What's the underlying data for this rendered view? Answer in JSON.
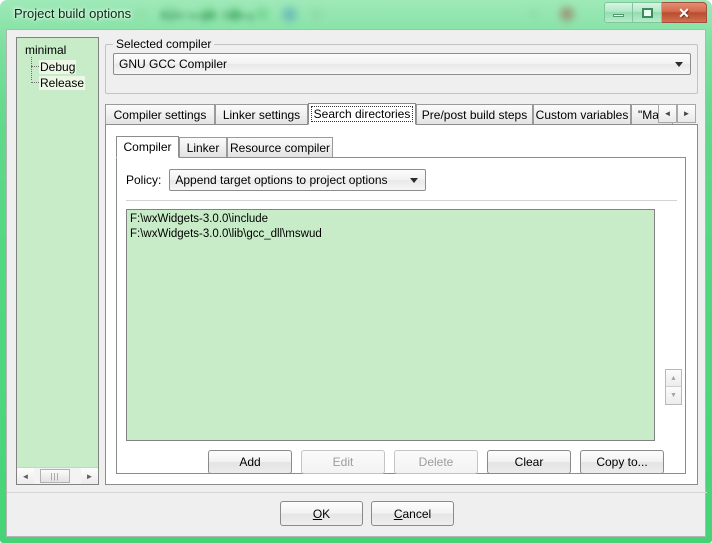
{
  "window": {
    "title": "Project build options",
    "glass_ghost_text": "Build target: Debug",
    "caption": {
      "minimize": "–",
      "maximize": "□",
      "close": "✕"
    }
  },
  "tree": {
    "root": "minimal",
    "children": [
      "Debug",
      "Release"
    ],
    "scroll_left": "◄",
    "scroll_right": "►",
    "thumb_grip": "|||"
  },
  "compiler_group": {
    "label": "Selected compiler",
    "selected": "GNU GCC Compiler"
  },
  "tabs": {
    "items": [
      {
        "label": "Compiler settings",
        "active": false
      },
      {
        "label": "Linker settings",
        "active": false
      },
      {
        "label": "Search directories",
        "active": true
      },
      {
        "label": "Pre/post build steps",
        "active": false
      },
      {
        "label": "Custom variables",
        "active": false
      },
      {
        "label": "\"Make\"",
        "active": false
      }
    ],
    "scroll_prev": "◄",
    "scroll_next": "►"
  },
  "inner_tabs": {
    "items": [
      {
        "label": "Compiler",
        "active": true
      },
      {
        "label": "Linker",
        "active": false
      },
      {
        "label": "Resource compiler",
        "active": false
      }
    ]
  },
  "policy": {
    "label": "Policy:",
    "selected": "Append target options to project options"
  },
  "directories": {
    "items": [
      "F:\\wxWidgets-3.0.0\\include",
      "F:\\wxWidgets-3.0.0\\lib\\gcc_dll\\mswud"
    ]
  },
  "spinner": {
    "up": "▲",
    "down": "▼"
  },
  "actions": [
    {
      "label": "Add",
      "enabled": true
    },
    {
      "label": "Edit",
      "enabled": false
    },
    {
      "label": "Delete",
      "enabled": false
    },
    {
      "label": "Clear",
      "enabled": true
    },
    {
      "label": "Copy to...",
      "enabled": true
    }
  ],
  "dialog_buttons": {
    "ok": {
      "mnemonic": "O",
      "rest": "K"
    },
    "cancel": {
      "mnemonic": "C",
      "rest": "ancel"
    }
  },
  "colors": {
    "frame_green": "#4fd67f",
    "list_green": "#c8ecc8",
    "dialog_gray": "#efefef",
    "close_red": "#c4522f"
  }
}
